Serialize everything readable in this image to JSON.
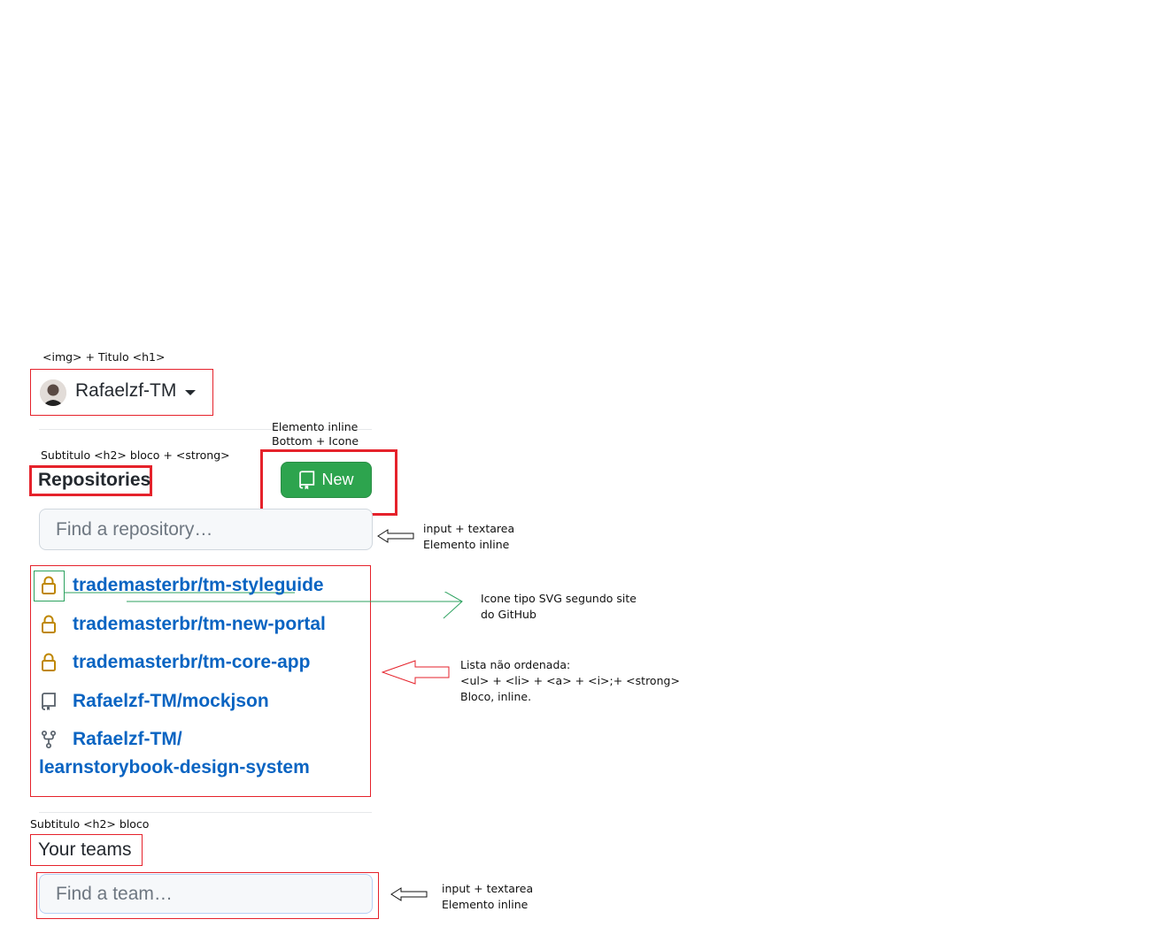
{
  "annotations": {
    "header_note": "<img> + Titulo <h1>",
    "button_note_1": "Elemento inline",
    "button_note_2": "Bottom + Icone",
    "repos_subtitle_note": "Subtitulo <h2> bloco + <strong>",
    "input_note_1": "input + textarea",
    "input_note_2": "Elemento inline",
    "svg_note_1": "Icone tipo SVG segundo site",
    "svg_note_2": "do GitHub",
    "list_note_1": "Lista não ordenada:",
    "list_note_2": "<ul> + <li> + <a> + <i>;+ <strong>",
    "list_note_3": "Bloco, inline.",
    "teams_subtitle_note": "Subtitulo <h2>  bloco",
    "team_input_note_1": "input + textarea",
    "team_input_note_2": "Elemento inline"
  },
  "header": {
    "username": "Rafaelzf-TM"
  },
  "repositories": {
    "title": "Repositories",
    "new_button_label": "New",
    "search_placeholder": "Find a repository…",
    "items": [
      {
        "name": "trademasterbr/tm-styleguide",
        "icon": "lock-icon"
      },
      {
        "name": "trademasterbr/tm-new-portal",
        "icon": "lock-icon"
      },
      {
        "name": "trademasterbr/tm-core-app",
        "icon": "lock-icon"
      },
      {
        "name": "Rafaelzf-TM/mockjson",
        "icon": "repo-icon"
      },
      {
        "name_line1": "Rafaelzf-TM/",
        "name_line2": "learnstorybook-design-system",
        "icon": "fork-icon"
      }
    ]
  },
  "teams": {
    "title": "Your teams",
    "search_placeholder": "Find a team…"
  },
  "colors": {
    "accent_green": "#2da44e",
    "link_blue": "#0a64c2",
    "lock_gold": "#bf8700",
    "annotation_red": "#e5222b",
    "annotation_green": "#2ca25f"
  }
}
